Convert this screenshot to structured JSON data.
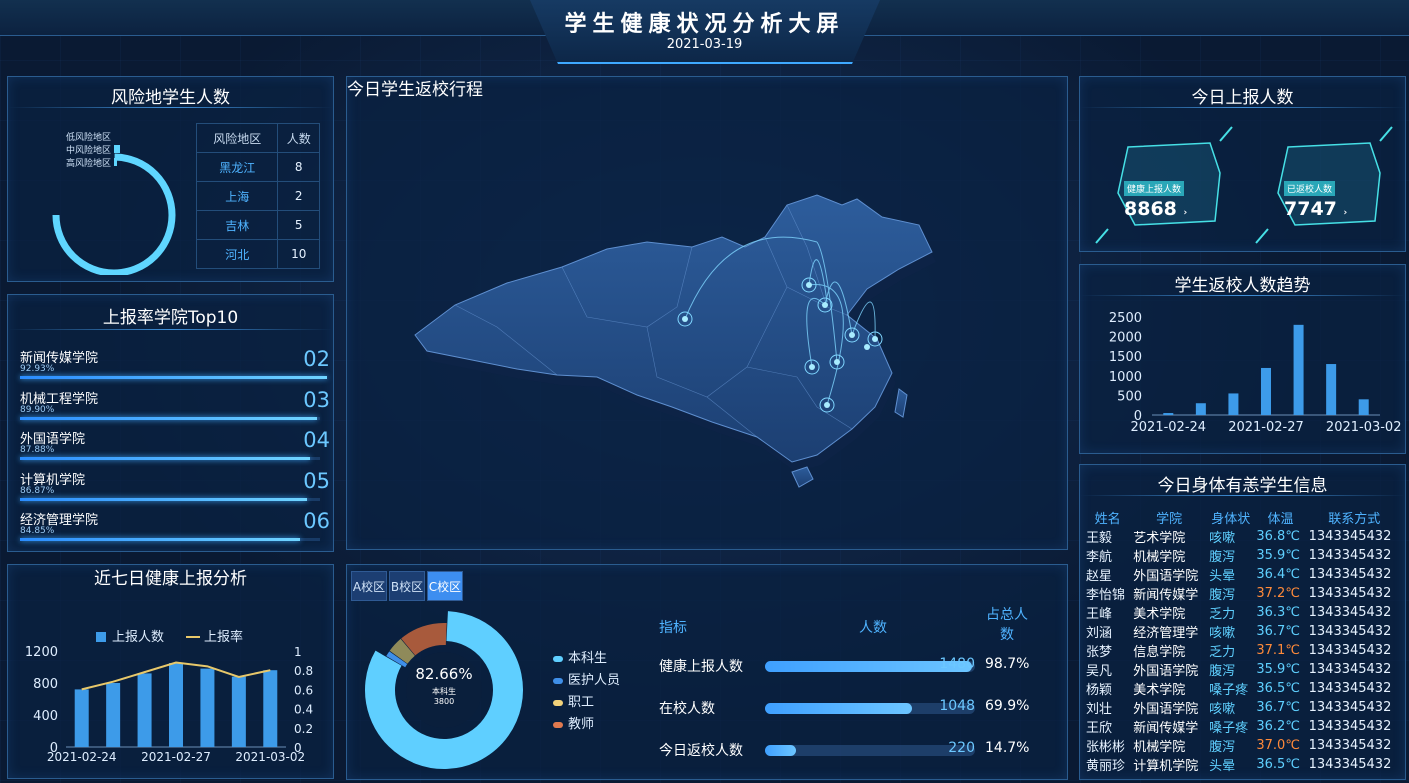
{
  "header": {
    "title": "学生健康状况分析大屏",
    "date": "2021-03-19"
  },
  "risk_panel": {
    "title": "风险地学生人数",
    "ring_legend": [
      "低风险地区",
      "中风险地区",
      "高风险地区"
    ],
    "table_headers": [
      "风险地区",
      "人数"
    ],
    "rows": [
      {
        "region": "黑龙江",
        "count": "8"
      },
      {
        "region": "上海",
        "count": "2"
      },
      {
        "region": "吉林",
        "count": "5"
      },
      {
        "region": "河北",
        "count": "10"
      }
    ]
  },
  "top10_panel": {
    "title": "上报率学院Top10",
    "items": [
      {
        "name": "新闻传媒学院",
        "pct": "92.93%",
        "rank": "02",
        "value": 0.9293
      },
      {
        "name": "机械工程学院",
        "pct": "89.90%",
        "rank": "03",
        "value": 0.899
      },
      {
        "name": "外国语学院",
        "pct": "87.88%",
        "rank": "04",
        "value": 0.8788
      },
      {
        "name": "计算机学院",
        "pct": "86.87%",
        "rank": "05",
        "value": 0.8687
      },
      {
        "name": "经济管理学院",
        "pct": "84.85%",
        "rank": "06",
        "value": 0.8485
      }
    ]
  },
  "weekly_panel": {
    "title": "近七日健康上报分析"
  },
  "map_panel": {
    "title": "今日学生返校行程"
  },
  "report_panel": {
    "title": "今日上报人数",
    "cards": [
      {
        "label": "健康上报人数",
        "value": "8868"
      },
      {
        "label": "已返校人数",
        "value": "7747"
      }
    ]
  },
  "trend_panel": {
    "title": "学生返校人数趋势"
  },
  "campus_panel": {
    "tabs": [
      "A校区",
      "B校区",
      "C校区"
    ],
    "active_tab": "C校区",
    "donut": {
      "percent": "82.66%",
      "label": "本科生",
      "count": "3800"
    },
    "legend": [
      {
        "name": "本科生",
        "color": "#5fcfff"
      },
      {
        "name": "医护人员",
        "color": "#3f8fe8"
      },
      {
        "name": "职工",
        "color": "#f2d27a"
      },
      {
        "name": "教师",
        "color": "#e0794f"
      }
    ],
    "table_headers": {
      "metric": "指标",
      "count": "人数",
      "share": "占总人数"
    },
    "stats": [
      {
        "label": "健康上报人数",
        "count": "1480",
        "pct": "98.7%",
        "ratio": 0.987
      },
      {
        "label": "在校人数",
        "count": "1048",
        "pct": "69.9%",
        "ratio": 0.699
      },
      {
        "label": "今日返校人数",
        "count": "220",
        "pct": "14.7%",
        "ratio": 0.147
      }
    ]
  },
  "symptom_panel": {
    "title": "今日身体有恙学生信息",
    "headers": [
      "姓名",
      "学院",
      "身体状",
      "体温",
      "联系方式"
    ],
    "rows": [
      {
        "name": "王毅",
        "dept": "艺术学院",
        "symptom": "咳嗽",
        "temp": "36.8℃",
        "phone": "1343345432"
      },
      {
        "name": "李航",
        "dept": "机械学院",
        "symptom": "腹泻",
        "temp": "35.9℃",
        "phone": "1343345432"
      },
      {
        "name": "赵星",
        "dept": "外国语学院",
        "symptom": "头晕",
        "temp": "36.4℃",
        "phone": "1343345432"
      },
      {
        "name": "李怡锦",
        "dept": "新闻传媒学",
        "symptom": "腹泻",
        "temp": "37.2℃",
        "phone": "1343345432"
      },
      {
        "name": "王峰",
        "dept": "美术学院",
        "symptom": "乏力",
        "temp": "36.3℃",
        "phone": "1343345432"
      },
      {
        "name": "刘涵",
        "dept": "经济管理学",
        "symptom": "咳嗽",
        "temp": "36.7℃",
        "phone": "1343345432"
      },
      {
        "name": "张梦",
        "dept": "信息学院",
        "symptom": "乏力",
        "temp": "37.1℃",
        "phone": "1343345432"
      },
      {
        "name": "吴凡",
        "dept": "外国语学院",
        "symptom": "腹泻",
        "temp": "35.9℃",
        "phone": "1343345432"
      },
      {
        "name": "杨颖",
        "dept": "美术学院",
        "symptom": "嗓子疼",
        "temp": "36.5℃",
        "phone": "1343345432"
      },
      {
        "name": "刘壮",
        "dept": "外国语学院",
        "symptom": "咳嗽",
        "temp": "36.7℃",
        "phone": "1343345432"
      },
      {
        "name": "王欣",
        "dept": "新闻传媒学",
        "symptom": "嗓子疼",
        "temp": "36.2℃",
        "phone": "1343345432"
      },
      {
        "name": "张彬彬",
        "dept": "机械学院",
        "symptom": "腹泻",
        "temp": "37.0℃",
        "phone": "1343345432"
      },
      {
        "name": "黄丽珍",
        "dept": "计算机学院",
        "symptom": "头晕",
        "temp": "36.5℃",
        "phone": "1343345432"
      }
    ]
  },
  "colors": {
    "accent": "#3fa9ff",
    "bar": "#3d9be9",
    "line": "#e8c86a",
    "hot": "#ff8a3a"
  },
  "chart_data": [
    {
      "type": "pie",
      "chart": "risk-ring",
      "categories": [
        "低风险地区",
        "中风险地区",
        "高风险地区"
      ],
      "values": [
        25,
        2,
        0.5
      ]
    },
    {
      "type": "bar",
      "chart": "weekly-report",
      "title": "近七日健康上报分析",
      "categories": [
        "2021-02-24",
        "2021-02-25",
        "2021-02-26",
        "2021-02-27",
        "2021-02-28",
        "2021-03-01",
        "2021-03-02"
      ],
      "x_tick_labels": [
        "2021-02-24",
        "2021-02-27",
        "2021-03-02"
      ],
      "series": [
        {
          "name": "上报人数",
          "type": "bar",
          "axis": "left",
          "values": [
            720,
            800,
            920,
            1050,
            980,
            880,
            960
          ]
        },
        {
          "name": "上报率",
          "type": "line",
          "axis": "right",
          "values": [
            0.6,
            0.68,
            0.78,
            0.88,
            0.84,
            0.73,
            0.8
          ]
        }
      ],
      "ylim": [
        0,
        1200
      ],
      "yticks": [
        0,
        400,
        800,
        1200
      ],
      "y2lim": [
        0,
        1
      ],
      "y2ticks": [
        0,
        0.2,
        0.4,
        0.6,
        0.8,
        1
      ],
      "legend": "top"
    },
    {
      "type": "bar",
      "chart": "return-trend",
      "title": "学生返校人数趋势",
      "categories": [
        "2021-02-24",
        "2021-02-25",
        "2021-02-26",
        "2021-02-27",
        "2021-02-28",
        "2021-03-01",
        "2021-03-02"
      ],
      "x_tick_labels": [
        "2021-02-24",
        "2021-02-27",
        "2021-03-02"
      ],
      "values": [
        50,
        300,
        550,
        1200,
        2300,
        1300,
        400
      ],
      "ylim": [
        0,
        2500
      ],
      "yticks": [
        0,
        500,
        1000,
        1500,
        2000,
        2500
      ]
    },
    {
      "type": "pie",
      "chart": "campus-donut",
      "categories": [
        "本科生",
        "医护人员",
        "职工",
        "教师"
      ],
      "values": [
        82.66,
        1.5,
        4,
        11.84
      ]
    }
  ]
}
